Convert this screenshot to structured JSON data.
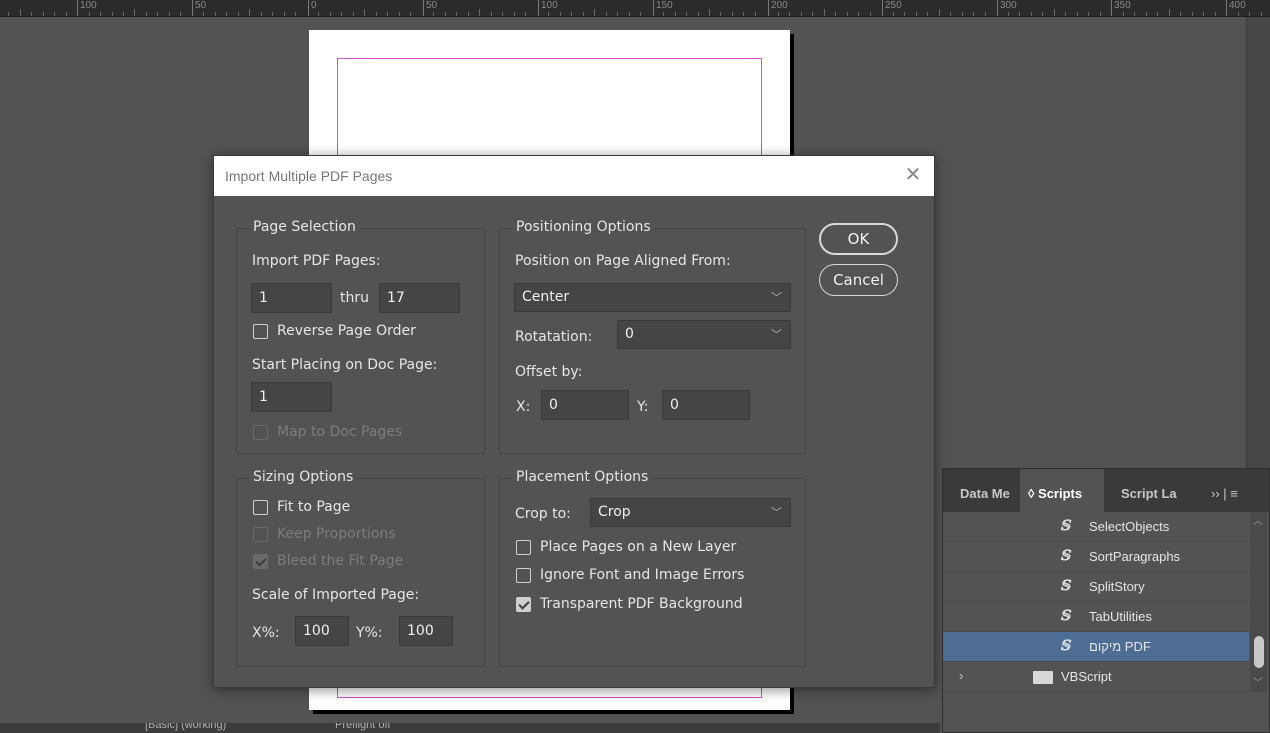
{
  "ruler": {
    "labels": [
      "100",
      "50",
      "0",
      "50",
      "100",
      "150",
      "200",
      "250",
      "300",
      "350",
      "400"
    ]
  },
  "dialog": {
    "title": "Import Multiple PDF Pages",
    "close_icon": "close-icon",
    "page_selection": {
      "legend": "Page Selection",
      "import_label": "Import PDF Pages:",
      "from_value": "1",
      "thru_label": "thru",
      "to_value": "17",
      "reverse_label": "Reverse Page Order",
      "reverse_checked": false,
      "start_label": "Start Placing on Doc Page:",
      "start_value": "1",
      "map_label": "Map to Doc Pages",
      "map_checked": false
    },
    "positioning": {
      "legend": "Positioning Options",
      "aligned_label": "Position on Page Aligned From:",
      "aligned_value": "Center",
      "rotation_label": "Rotatation:",
      "rotation_value": "0",
      "offset_label": "Offset by:",
      "x_label": "X:",
      "x_value": "0",
      "y_label": "Y:",
      "y_value": "0"
    },
    "sizing": {
      "legend": "Sizing Options",
      "fit_label": "Fit to Page",
      "fit_checked": false,
      "keep_label": "Keep Proportions",
      "keep_checked": false,
      "bleed_label": "Bleed the Fit Page",
      "bleed_checked": true,
      "scale_label": "Scale of Imported Page:",
      "xpct_label": "X%:",
      "xpct_value": "100",
      "ypct_label": "Y%:",
      "ypct_value": "100"
    },
    "placement": {
      "legend": "Placement Options",
      "crop_label": "Crop to:",
      "crop_value": "Crop",
      "new_layer_label": "Place Pages on a New Layer",
      "new_layer_checked": false,
      "ignore_label": "Ignore Font and Image Errors",
      "ignore_checked": false,
      "transparent_label": "Transparent PDF Background",
      "transparent_checked": true
    },
    "ok_label": "OK",
    "cancel_label": "Cancel"
  },
  "panel": {
    "tabs": [
      {
        "label": "Data Me"
      },
      {
        "label": "◊ Scripts"
      },
      {
        "label": "Script La"
      }
    ],
    "overflow": "›› | ≡",
    "items": [
      {
        "label": "SelectObjects",
        "type": "script"
      },
      {
        "label": "SortParagraphs",
        "type": "script"
      },
      {
        "label": "SplitStory",
        "type": "script"
      },
      {
        "label": "TabUtilities",
        "type": "script"
      },
      {
        "label": "מיקום PDF",
        "type": "script",
        "selected": true
      },
      {
        "label": "VBScript",
        "type": "folder"
      }
    ]
  },
  "status": {
    "workspace": "[Basic] (working)",
    "preflight": "Preflight off"
  }
}
